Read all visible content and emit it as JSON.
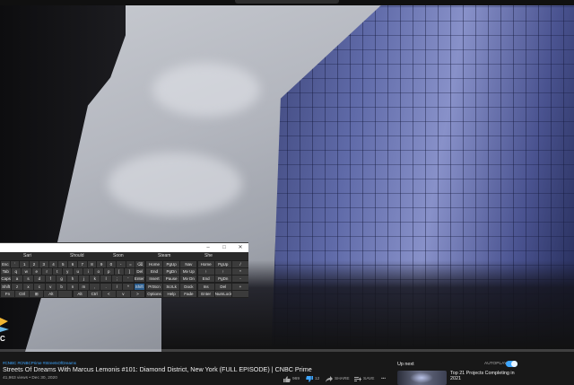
{
  "video": {
    "osk": {
      "window_buttons": [
        "–",
        "□",
        "✕"
      ],
      "suggestions": [
        "Sari",
        "Should",
        "Soon",
        "Steam",
        "She"
      ],
      "rows": [
        {
          "keys": [
            "Esc",
            "`",
            "1",
            "2",
            "3",
            "4",
            "5",
            "6",
            "7",
            "8",
            "9",
            "0",
            "-",
            "=",
            "⌫"
          ]
        },
        {
          "keys": [
            "Tab",
            "q",
            "w",
            "e",
            "r",
            "t",
            "y",
            "u",
            "i",
            "o",
            "p",
            "[",
            "]",
            "Del"
          ]
        },
        {
          "keys": [
            "Caps",
            "a",
            "s",
            "d",
            "f",
            "g",
            "h",
            "j",
            "k",
            "l",
            ";",
            "'",
            "Enter"
          ]
        },
        {
          "keys": [
            "Shift",
            "z",
            "x",
            "c",
            "v",
            "b",
            "n",
            "m",
            ",",
            ".",
            "/",
            "^",
            "Shift"
          ]
        },
        {
          "keys": [
            "Fn",
            "Ctrl",
            "⊞",
            "Alt",
            "",
            "Alt",
            "Ctrl",
            "<",
            "v",
            ">"
          ]
        }
      ],
      "nav_keys": [
        [
          "Home",
          "PgUp",
          "Nav",
          "Home",
          "PgUp",
          "/"
        ],
        [
          "End",
          "PgDn",
          "Mv Up",
          "↑",
          "↑",
          "*"
        ],
        [
          "Insert",
          "Pause",
          "Mv Dn",
          "End",
          "PgDn",
          "-"
        ],
        [
          "PrtScn",
          "ScrLk",
          "Dock",
          "Ins",
          "Del",
          "+"
        ],
        [
          "Options",
          "Help",
          "Fade",
          "Enter",
          "NumLock",
          ""
        ]
      ],
      "wordmark": "C"
    }
  },
  "info": {
    "hashtags": "#CNBC #CNBCPrime #StreetsOfDreams",
    "title": "Streets Of Dreams With Marcus Lemonis #101: Diamond District, New York (FULL EPISODE) | CNBC Prime",
    "views_date": "41,963 views • Dec 30, 2020",
    "likes": "969",
    "dislikes": "12",
    "share_label": "SHARE",
    "save_label": "SAVE",
    "more_label": "•••"
  },
  "sidebar": {
    "up_next_label": "Up next",
    "autoplay_label": "AUTOPLAY",
    "autoplay_on": true,
    "next_video_title": "Top 21 Projects Completing in 2021"
  },
  "colors": {
    "accent": "#3ea6ff",
    "background": "#181818",
    "text": "#f1f1f1",
    "muted": "#aaaaaa"
  }
}
